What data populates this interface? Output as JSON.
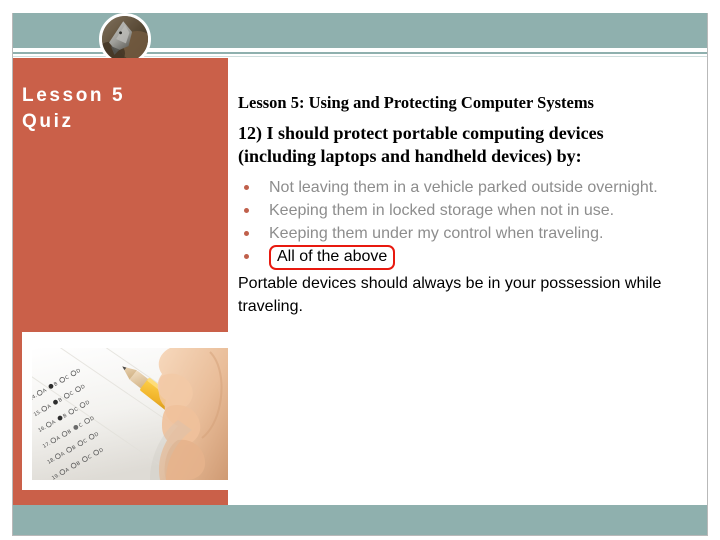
{
  "slide": {
    "panel_title": "Lesson 5\nQuiz",
    "panel_title_line1": "Lesson 5",
    "panel_title_line2": "Quiz"
  },
  "theme": {
    "accent_orange": "#ca6049",
    "accent_teal": "#8fb0ae",
    "highlight_red": "#e8190f",
    "body_gray": "#8d8d8d",
    "white": "#ffffff"
  },
  "header": {
    "logo_alt": "circular-photo-logo"
  },
  "content": {
    "lesson_heading": "Lesson 5: Using and Protecting Computer Systems",
    "question": "12) I should protect portable computing devices (including laptops and handheld devices) by:",
    "answers": [
      {
        "label": "Not leaving them in a vehicle parked outside overnight.",
        "correct": false
      },
      {
        "label": "Keeping them in locked storage when not in use.",
        "correct": false
      },
      {
        "label": "Keeping them under my control when traveling.",
        "correct": false
      },
      {
        "label": "All of the above",
        "correct": true
      }
    ],
    "explanation": "Portable devices should always be in your possession while traveling."
  },
  "media": {
    "scantron_photo_alt": "hand-with-pencil-filling-answer-sheet"
  }
}
